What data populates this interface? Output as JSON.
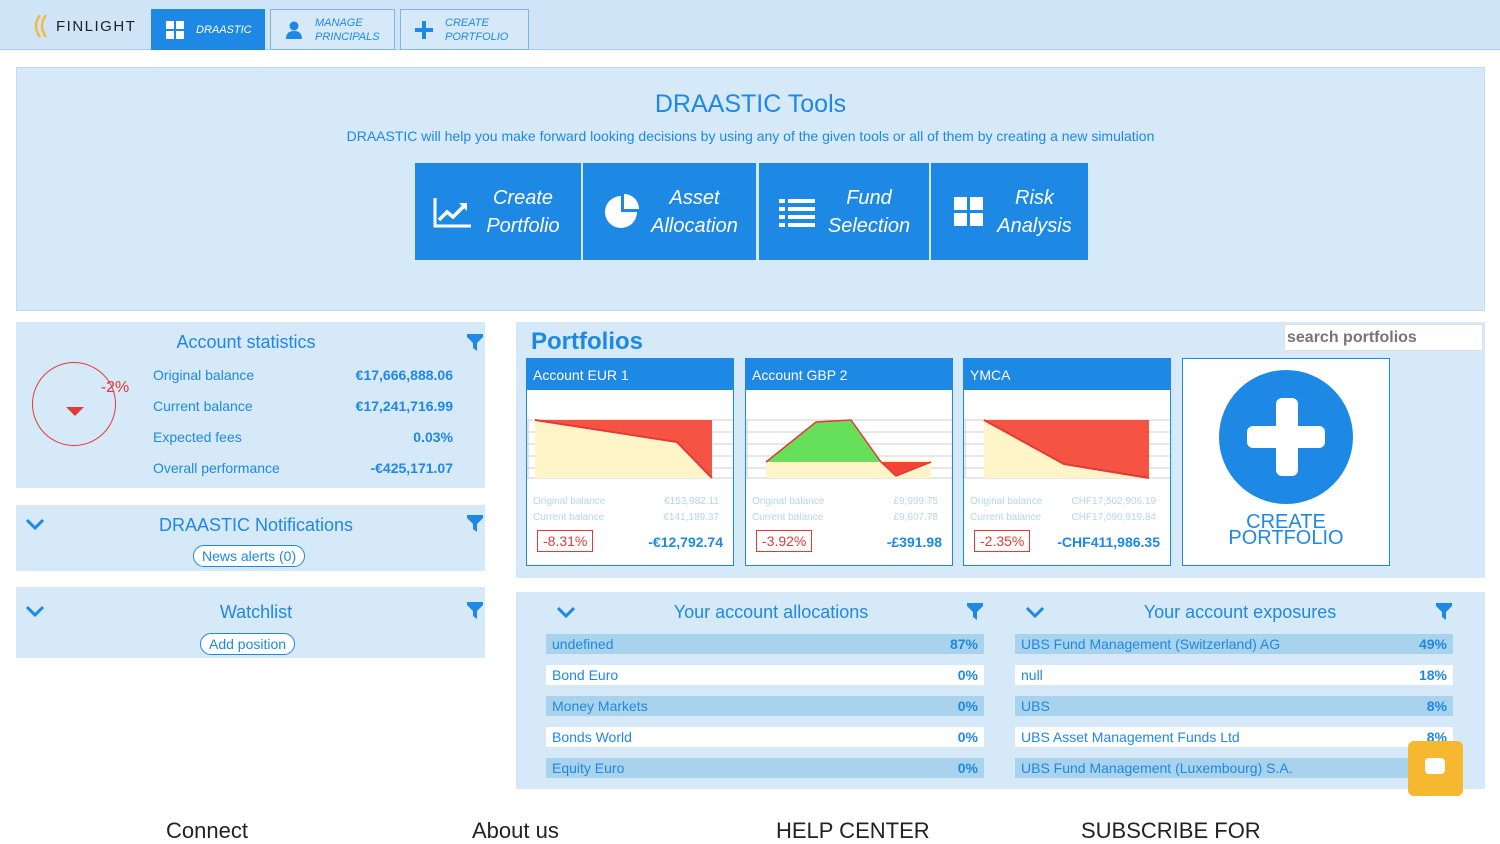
{
  "brand": {
    "name": "FINLIGHT"
  },
  "nav": {
    "tabs": [
      {
        "label": "DRAASTIC"
      },
      {
        "label": "MANAGE\nPRINCIPALS"
      },
      {
        "label": "CREATE\nPORTFOLIO"
      }
    ]
  },
  "tools": {
    "title": "DRAASTIC Tools",
    "subtitle": "DRAASTIC will help you make forward looking decisions by using any of the given tools or all of them by creating a new simulation",
    "buttons": [
      {
        "line1": "Create",
        "line2": "Portfolio",
        "icon": "chart-icon"
      },
      {
        "line1": "Asset",
        "line2": "Allocation",
        "icon": "pie-icon"
      },
      {
        "line1": "Fund",
        "line2": "Selection",
        "icon": "list-icon"
      },
      {
        "line1": "Risk",
        "line2": "Analysis",
        "icon": "grid-icon"
      }
    ]
  },
  "account_stats": {
    "title": "Account statistics",
    "performance_badge": "-2%",
    "rows": [
      {
        "label": "Original balance",
        "value": "€17,666,888.06"
      },
      {
        "label": "Current balance",
        "value": "€17,241,716.99"
      },
      {
        "label": "Expected fees",
        "value": "0.03%"
      },
      {
        "label": "Overall performance",
        "value": "-€425,171.07"
      }
    ]
  },
  "notifications": {
    "title": "DRAASTIC Notifications",
    "button": "News alerts (0)"
  },
  "watchlist": {
    "title": "Watchlist",
    "button": "Add position"
  },
  "portfolios": {
    "title": "Portfolios",
    "search_placeholder": "search portfolios",
    "create_label_1": "CREATE",
    "create_label_2": "PORTFOLIO",
    "cards": [
      {
        "name": "Account EUR 1",
        "orig_label": "Original balance",
        "orig": "€153,982.11",
        "cur_label": "Current balance",
        "cur": "€141,189.37",
        "perf": "-8.31%",
        "diff": "-€12,792.74"
      },
      {
        "name": "Account GBP 2",
        "orig_label": "Original balance",
        "orig": "£9,999.75",
        "cur_label": "Current balance",
        "cur": "£9,607.78",
        "perf": "-3.92%",
        "diff": "-£391.98"
      },
      {
        "name": "YMCA",
        "orig_label": "Original balance",
        "orig": "CHF17,502,906.19",
        "cur_label": "Current balance",
        "cur": "CHF17,090,919.84",
        "perf": "-2.35%",
        "diff": "-CHF411,986.35"
      }
    ]
  },
  "allocations": {
    "title": "Your account allocations",
    "rows": [
      {
        "label": "undefined",
        "value": "87%"
      },
      {
        "label": "Bond Euro",
        "value": "0%"
      },
      {
        "label": "Money Markets",
        "value": "0%"
      },
      {
        "label": "Bonds World",
        "value": "0%"
      },
      {
        "label": "Equity Euro",
        "value": "0%"
      }
    ]
  },
  "exposures": {
    "title": "Your account exposures",
    "rows": [
      {
        "label": "UBS Fund Management (Switzerland) AG",
        "value": "49%"
      },
      {
        "label": "null",
        "value": "18%"
      },
      {
        "label": "UBS",
        "value": "8%"
      },
      {
        "label": "UBS Asset Management Funds Ltd",
        "value": "8%"
      },
      {
        "label": "UBS Fund Management (Luxembourg) S.A.",
        "value": ""
      }
    ]
  },
  "footer": {
    "col1": "Connect",
    "col2": "About us",
    "col3": "HELP CENTER",
    "col4": "SUBSCRIBE FOR"
  },
  "colors": {
    "accent": "#1e88e5",
    "panel": "#d6e9f9",
    "negative": "#e53935",
    "chat": "#f5b82e"
  }
}
